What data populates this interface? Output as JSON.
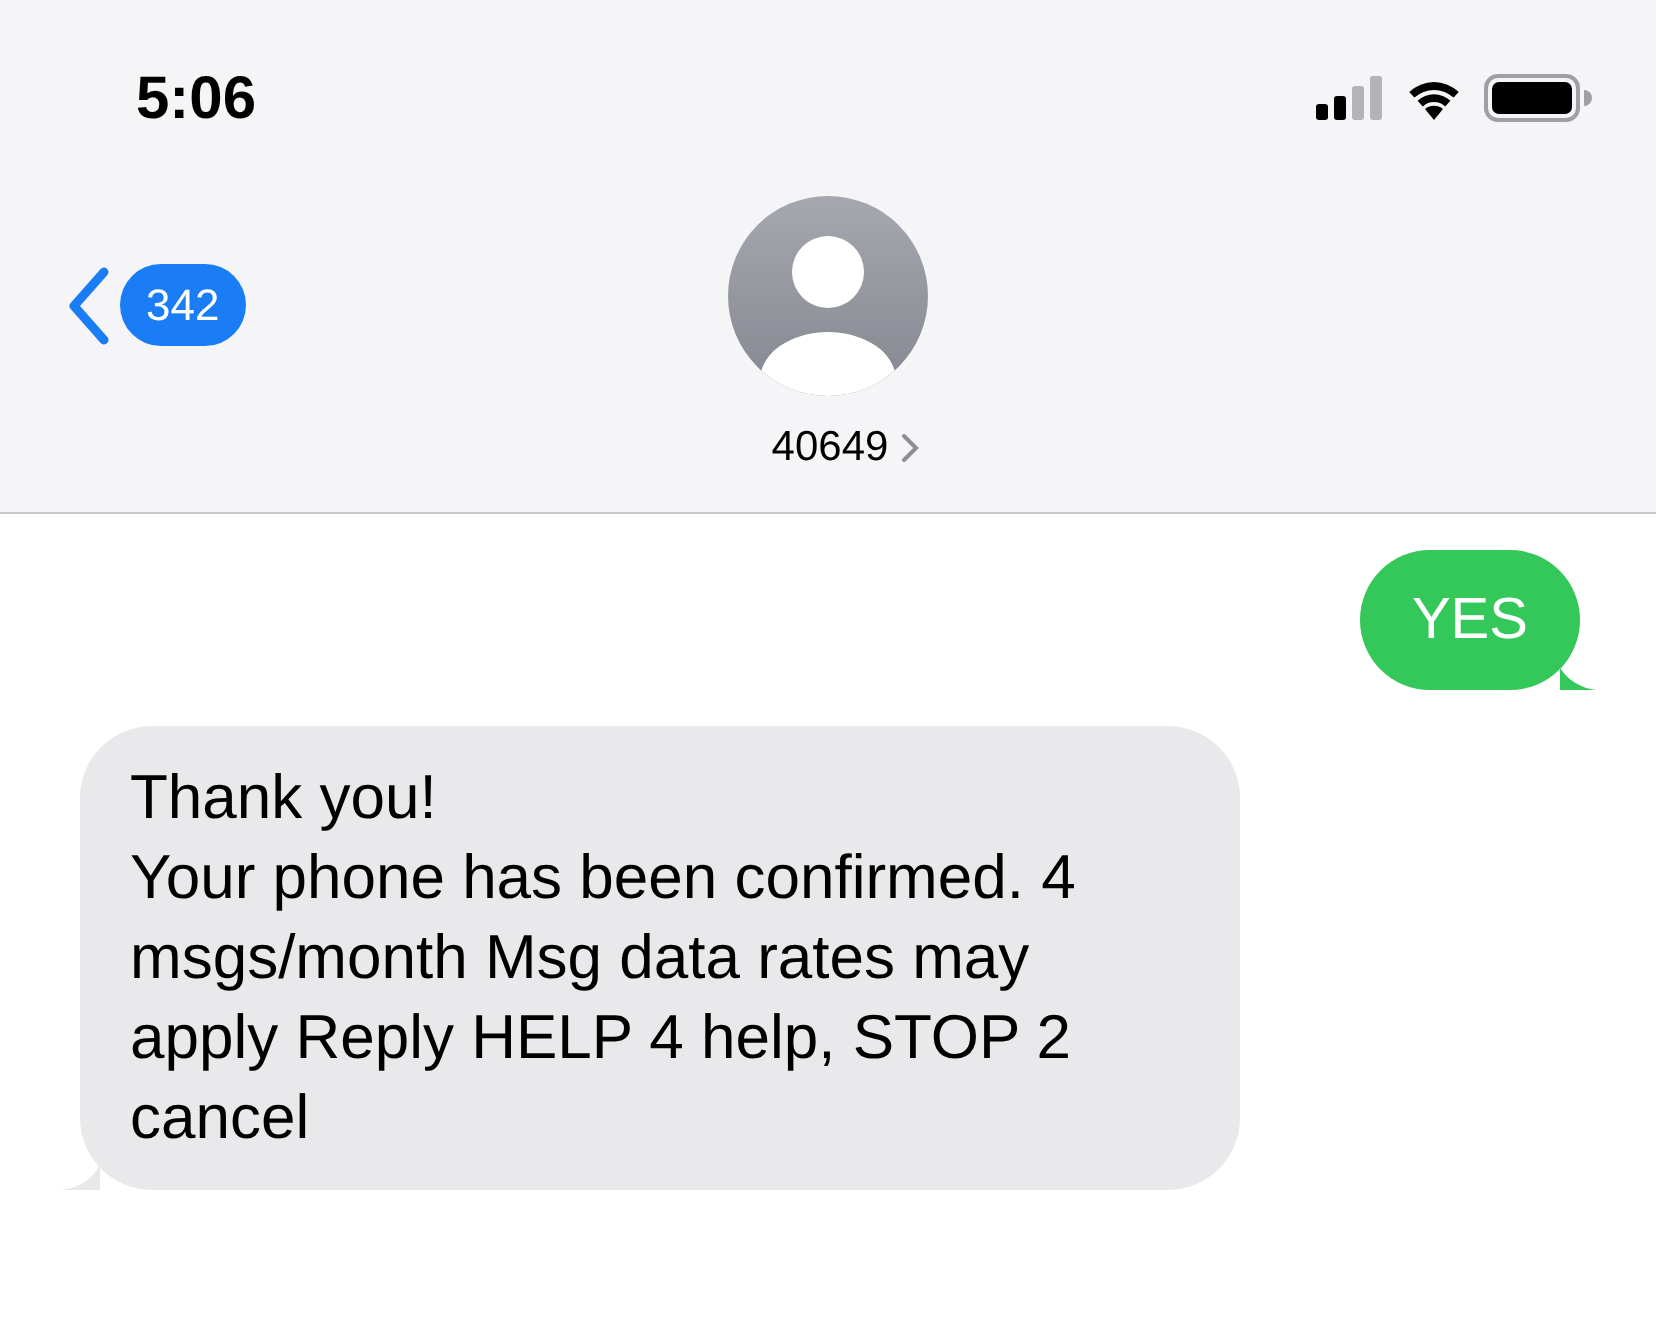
{
  "status_bar": {
    "time": "5:06"
  },
  "nav": {
    "back_count": "342",
    "contact": "40649"
  },
  "messages": [
    {
      "kind": "sent",
      "text": "YES"
    },
    {
      "kind": "received",
      "text": "Thank you!\nYour phone has been confirmed. 4 msgs/month Msg data rates may apply Reply HELP 4 help, STOP 2 cancel"
    }
  ]
}
